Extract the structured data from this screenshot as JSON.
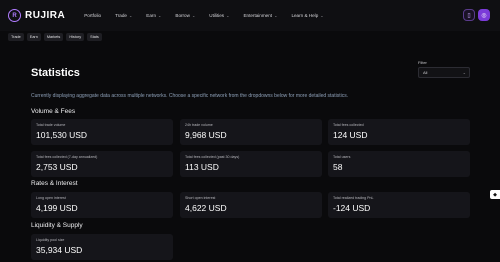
{
  "brand": {
    "name": "RUJIRA",
    "logo_icon": "rujira-logo-icon"
  },
  "nav": [
    {
      "label": "Portfolio",
      "has_menu": false
    },
    {
      "label": "Trade",
      "has_menu": true
    },
    {
      "label": "Earn",
      "has_menu": true
    },
    {
      "label": "Borrow",
      "has_menu": true
    },
    {
      "label": "Utilities",
      "has_menu": true
    },
    {
      "label": "Entertainment",
      "has_menu": true
    },
    {
      "label": "Learn & Help",
      "has_menu": true
    }
  ],
  "subnav": [
    "Trade",
    "Earn",
    "Markets",
    "History",
    "Stats"
  ],
  "page": {
    "title": "Statistics",
    "description": "Currently displaying aggregate data across multiple networks. Choose a specific network from the dropdowns below for more detailed statistics."
  },
  "filter": {
    "label": "Filter",
    "value": "All"
  },
  "sections": {
    "volume": {
      "title": "Volume & Fees",
      "cards": [
        {
          "label": "Total trade volume",
          "value": "101,530 USD"
        },
        {
          "label": "24h trade volume",
          "value": "9,968 USD"
        },
        {
          "label": "Total fees collected",
          "value": "124 USD"
        },
        {
          "label": "Total fees collected (7-day annualized)",
          "value": "2,753 USD"
        },
        {
          "label": "Total fees collected (past 30 days)",
          "value": "113 USD"
        },
        {
          "label": "Total users",
          "value": "58"
        }
      ]
    },
    "rates": {
      "title": "Rates & Interest",
      "cards": [
        {
          "label": "Long open interest",
          "value": "4,199 USD"
        },
        {
          "label": "Short open interest",
          "value": "4,622 USD"
        },
        {
          "label": "Total realized trading PnL",
          "value": "-124 USD"
        }
      ]
    },
    "liquidity": {
      "title": "Liquidity & Supply",
      "cards": [
        {
          "label": "Liquidity pool size",
          "value": "35,934 USD"
        }
      ]
    }
  },
  "colors": {
    "accent": "#7b3bd9",
    "background": "#0a0a0c",
    "card": "#15151a"
  }
}
